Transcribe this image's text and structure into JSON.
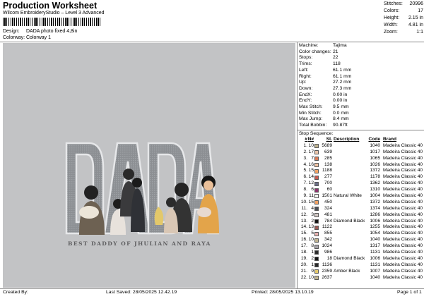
{
  "header": {
    "title": "Production Worksheet",
    "software": "Wilcom EmbroideryStudio – Level 3 Advanced",
    "design_label": "Design:",
    "design_value": "DADA photo fixed 4,8in",
    "colorway_label": "Colorway:",
    "colorway_value": "Colorway 1"
  },
  "summary": [
    {
      "label": "Stitches:",
      "value": "20996"
    },
    {
      "label": "Colors:",
      "value": "17"
    },
    {
      "label": "Height:",
      "value": "2.15 in"
    },
    {
      "label": "Width:",
      "value": "4.81 in"
    },
    {
      "label": "Zoom:",
      "value": "1:1"
    }
  ],
  "design": {
    "letters": [
      "D",
      "A",
      "D",
      "A"
    ],
    "tagline": "BEST DADDY OF JHULIAN AND RAYA"
  },
  "machine_info": [
    {
      "label": "Machine:",
      "value": "Tajima"
    },
    {
      "label": "Color changes:",
      "value": "21"
    },
    {
      "label": "Stops:",
      "value": "22"
    },
    {
      "label": "Trims:",
      "value": "118"
    },
    {
      "label": "Left:",
      "value": "61.1 mm"
    },
    {
      "label": "Right:",
      "value": "61.1 mm"
    },
    {
      "label": "Up:",
      "value": "27.2 mm"
    },
    {
      "label": "Down:",
      "value": "27.3 mm"
    },
    {
      "label": "EndX:",
      "value": "0.00 in"
    },
    {
      "label": "EndY:",
      "value": "0.00 in"
    },
    {
      "label": "Max Stitch:",
      "value": "9.5 mm"
    },
    {
      "label": "Min Stitch:",
      "value": "0.0 mm"
    },
    {
      "label": "Max Jump:",
      "value": "8.4 mm"
    },
    {
      "label": "Total Bobbin:",
      "value": "90.87ft"
    }
  ],
  "stop_sequence": {
    "title": "Stop Sequence:",
    "columns": {
      "num": "#",
      "n": "N#",
      "st": "St.",
      "description": "Description",
      "code": "Code",
      "brand": "Brand"
    },
    "rows": [
      {
        "num": "1.",
        "n": "10",
        "color": "#bfb38f",
        "st": "5689",
        "desc": "",
        "code": "1040",
        "brand": "Madeira Classic 40"
      },
      {
        "num": "2.",
        "n": "17",
        "color": "#e7c3a9",
        "st": "639",
        "desc": "",
        "code": "1017",
        "brand": "Madeira Classic 40"
      },
      {
        "num": "3.",
        "n": "7",
        "color": "#d77a57",
        "st": "285",
        "desc": "",
        "code": "1065",
        "brand": "Madeira Classic 40"
      },
      {
        "num": "4.",
        "n": "16",
        "color": "#f1c4a5",
        "st": "138",
        "desc": "",
        "code": "1026",
        "brand": "Madeira Classic 40"
      },
      {
        "num": "5.",
        "n": "15",
        "color": "#f2a162",
        "st": "1188",
        "desc": "",
        "code": "1372",
        "brand": "Madeira Classic 40"
      },
      {
        "num": "6.",
        "n": "14",
        "color": "#c8594f",
        "st": "277",
        "desc": "",
        "code": "1178",
        "brand": "Madeira Classic 40"
      },
      {
        "num": "7.",
        "n": "12",
        "color": "#6b6e86",
        "st": "700",
        "desc": "",
        "code": "1362",
        "brand": "Madeira Classic 40"
      },
      {
        "num": "8.",
        "n": "6",
        "color": "#8e2f6c",
        "st": "60",
        "desc": "",
        "code": "1310",
        "brand": "Madeira Classic 40"
      },
      {
        "num": "9.",
        "n": "11",
        "color": "#f4f4f0",
        "st": "1501",
        "desc": "Natural White",
        "code": "1004",
        "brand": "Madeira Classic 40"
      },
      {
        "num": "10.",
        "n": "15",
        "color": "#f2a162",
        "st": "450",
        "desc": "",
        "code": "1372",
        "brand": "Madeira Classic 40"
      },
      {
        "num": "11.",
        "n": "4",
        "color": "#4b4f58",
        "st": "324",
        "desc": "",
        "code": "1374",
        "brand": "Madeira Classic 40"
      },
      {
        "num": "12.",
        "n": "3",
        "color": "#d2c8c4",
        "st": "481",
        "desc": "",
        "code": "1286",
        "brand": "Madeira Classic 40"
      },
      {
        "num": "13.",
        "n": "2",
        "color": "#161616",
        "st": "784",
        "desc": "Diamond Black",
        "code": "1006",
        "brand": "Madeira Classic 40"
      },
      {
        "num": "14.",
        "n": "13",
        "color": "#9b5b55",
        "st": "1122",
        "desc": "",
        "code": "1255",
        "brand": "Madeira Classic 40"
      },
      {
        "num": "15.",
        "n": "5",
        "color": "#e8b3b1",
        "st": "855",
        "desc": "",
        "code": "1054",
        "brand": "Madeira Classic 40"
      },
      {
        "num": "16.",
        "n": "10",
        "color": "#bfb38f",
        "st": "342",
        "desc": "",
        "code": "1040",
        "brand": "Madeira Classic 40"
      },
      {
        "num": "17.",
        "n": "8",
        "color": "#a3a0a6",
        "st": "1024",
        "desc": "",
        "code": "1317",
        "brand": "Madeira Classic 40"
      },
      {
        "num": "18.",
        "n": "1",
        "color": "#2a2a2a",
        "st": "986",
        "desc": "",
        "code": "1131",
        "brand": "Madeira Classic 40"
      },
      {
        "num": "19.",
        "n": "2",
        "color": "#161616",
        "st": "18",
        "desc": "Diamond Black",
        "code": "1006",
        "brand": "Madeira Classic 40"
      },
      {
        "num": "20.",
        "n": "1",
        "color": "#2a2a2a",
        "st": "1136",
        "desc": "",
        "code": "1131",
        "brand": "Madeira Classic 40"
      },
      {
        "num": "21.",
        "n": "9",
        "color": "#e3c86a",
        "st": "2359",
        "desc": "Amber Black",
        "code": "1007",
        "brand": "Madeira Classic 40"
      },
      {
        "num": "22.",
        "n": "10",
        "color": "#bfb38f",
        "st": "2637",
        "desc": "",
        "code": "1040",
        "brand": "Madeira Classic 40"
      }
    ]
  },
  "footer": {
    "created_by": "Created By:",
    "last_saved": "Last Saved: 28/05/2025 12.42.19",
    "printed": "Printed: 28/05/2025 13.10.19",
    "page": "Page 1 of 1"
  }
}
